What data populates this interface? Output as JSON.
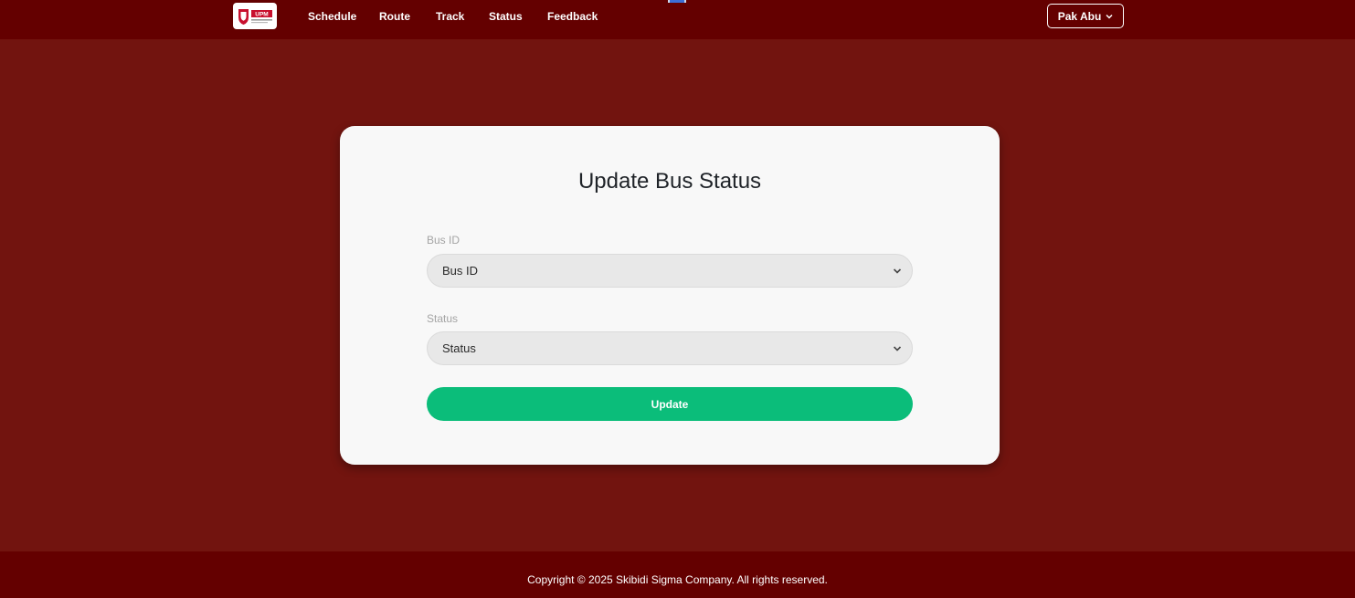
{
  "nav": {
    "logo_text": "UPM",
    "links": [
      "Schedule",
      "Route",
      "Track",
      "Status",
      "Feedback"
    ],
    "user": {
      "name": "Pak Abu",
      "icon": "chevron-down-icon"
    }
  },
  "form": {
    "title": "Update Bus Status",
    "bus_id": {
      "label": "Bus ID",
      "selected": "Bus ID",
      "icon": "chevron-down-icon"
    },
    "status": {
      "label": "Status",
      "selected": "Status",
      "icon": "chevron-down-icon"
    },
    "submit_label": "Update"
  },
  "footer": {
    "copyright": "Copyright © 2025 Skibidi Sigma Company. All rights reserved."
  },
  "colors": {
    "navbar": "#640000",
    "background": "#72140f",
    "card": "#f8f8f8",
    "accent": "#0bbd7a"
  }
}
